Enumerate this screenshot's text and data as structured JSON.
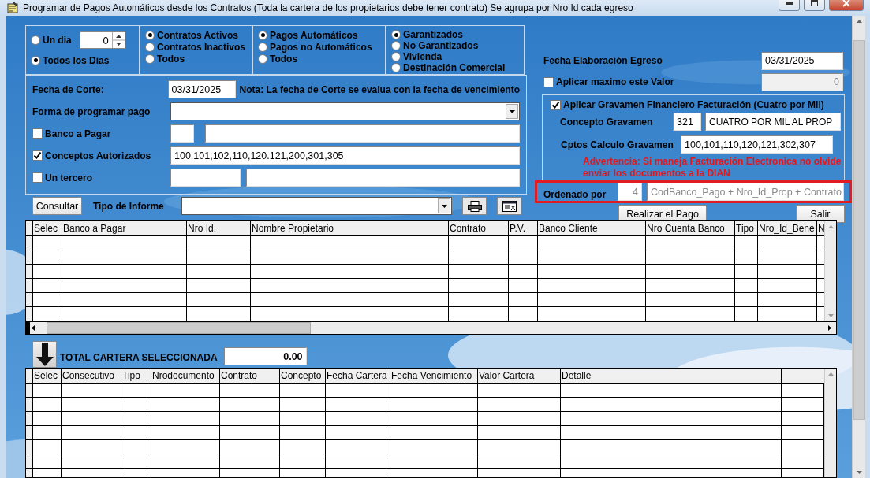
{
  "window": {
    "title": "Programar de Pagos Automáticos desde los Contratos (Toda la cartera de los propietarios debe tener contrato) Se agrupa por Nro Id cada egreso"
  },
  "filters": [
    {
      "spinner": "0",
      "options": [
        {
          "label": "Un dia",
          "selected": false
        },
        {
          "label": "Todos los Días",
          "selected": true
        }
      ]
    },
    {
      "options": [
        {
          "label": "Contratos Activos",
          "selected": true
        },
        {
          "label": "Contratos Inactivos",
          "selected": false
        },
        {
          "label": "Todos",
          "selected": false
        }
      ]
    },
    {
      "options": [
        {
          "label": "Pagos Automáticos",
          "selected": true
        },
        {
          "label": "Pagos no Automáticos",
          "selected": false
        },
        {
          "label": "Todos",
          "selected": false
        }
      ]
    },
    {
      "options": [
        {
          "label": "Garantizados",
          "selected": true
        },
        {
          "label": "No Garantizados",
          "selected": false
        },
        {
          "label": "Vivienda",
          "selected": false
        },
        {
          "label": "Destinación Comercial",
          "selected": false
        }
      ]
    }
  ],
  "form": [
    {
      "kind": "date",
      "label": "Fecha de Corte:",
      "value": "03/31/2025",
      "note": "Nota: La fecha de Corte se evalua con la fecha de vencimiento"
    },
    {
      "kind": "combo",
      "label": "Forma de programar pago"
    },
    {
      "kind": "codepair",
      "label": "Banco a Pagar",
      "checked": false
    },
    {
      "kind": "text",
      "label": "Conceptos Autorizados",
      "checked": true,
      "value": "100,101,102,110,120.121,200,301,305"
    },
    {
      "kind": "idpair",
      "label": "Un tercero",
      "checked": false
    }
  ],
  "toolbar": {
    "button": "Consultar",
    "label": "Tipo de Informe"
  },
  "right": {
    "elaboracion": {
      "label": "Fecha Elaboración Egreso",
      "value": "03/31/2025"
    },
    "maximo": {
      "label": "Aplicar maximo este Valor",
      "checked": false,
      "value": "0",
      "disabled": true
    },
    "gravamen": {
      "label": "Aplicar Gravamen Financiero Facturación (Cuatro por Mil)",
      "checked": true,
      "concepto_label": "Concepto Gravamen",
      "concepto_code": "321",
      "concepto_name": "CUATRO POR MIL AL PROP",
      "cptos_label": "Cptos Calculo Gravamen",
      "cptos_value": "100,101,110,120,121,302,307",
      "warning": "Advertencia: Si maneja Facturación Electronica no olvide enviar los documentos a la DIAN"
    },
    "ordenado": {
      "label": "Ordenado por",
      "code": "4",
      "value": "CodBanco_Pago + Nro_Id_Prop + Contrato",
      "highlighted": true
    }
  },
  "actions": [
    "Realizar el Pago",
    "Salir"
  ],
  "pagos_grid": {
    "columns": [
      "Selec",
      "Banco a Pagar",
      "Nro Id.",
      "Nombre Propietario",
      "Contrato",
      "P.V.",
      "Banco Cliente",
      "Nro Cuenta Banco",
      "Tipo",
      "Nro_Id_Bene",
      "N"
    ]
  },
  "total": {
    "label": "TOTAL CARTERA SELECCIONADA",
    "value": "0.00"
  },
  "cartera_grid": {
    "columns": [
      "Selec",
      "Consecutivo",
      "Tipo",
      "Nrodocumento",
      "Contrato",
      "Concepto",
      "Fecha Cartera",
      "Fecha Vencimiento",
      "Valor Cartera",
      "Detalle"
    ]
  }
}
